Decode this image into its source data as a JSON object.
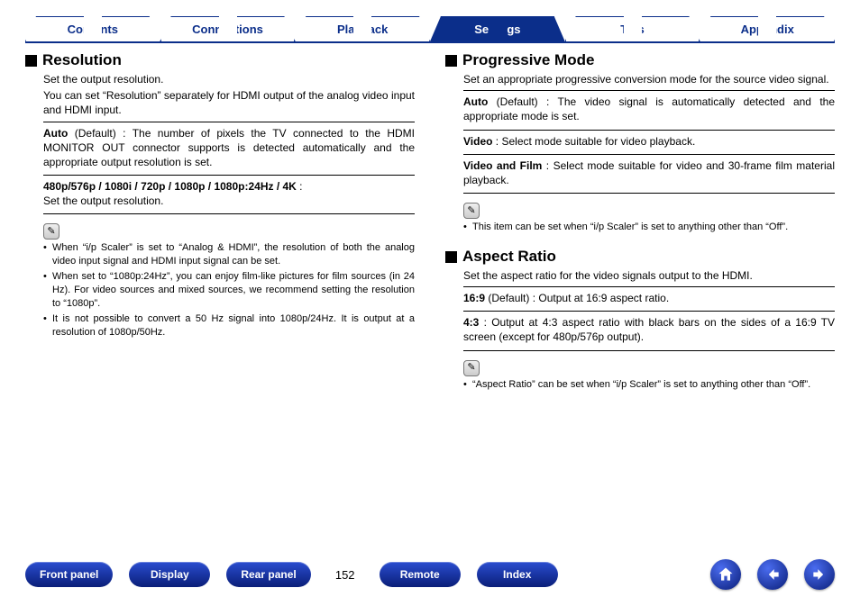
{
  "tabs": [
    {
      "label": "Contents",
      "active": false
    },
    {
      "label": "Connections",
      "active": false
    },
    {
      "label": "Playback",
      "active": false
    },
    {
      "label": "Settings",
      "active": true
    },
    {
      "label": "Tips",
      "active": false
    },
    {
      "label": "Appendix",
      "active": false
    }
  ],
  "left": {
    "resolution": {
      "heading": "Resolution",
      "intro1": "Set the output resolution.",
      "intro2": "You can set “Resolution” separately for HDMI output of the analog video input and HDMI input.",
      "auto_key": "Auto",
      "auto_default": " (Default) : ",
      "auto_desc": "The number of pixels the TV connected to the HDMI MONITOR OUT connector supports is detected automatically and the appropriate output resolution is set.",
      "modes_key": "480p/576p / 1080i / 720p / 1080p / 1080p:24Hz / 4K",
      "modes_sep": " :",
      "modes_desc": "Set the output resolution.",
      "notes": [
        "When “i/p Scaler” is set to “Analog & HDMI”, the resolution of both the analog video input signal and HDMI input signal can be set.",
        "When set to “1080p:24Hz”, you can enjoy film-like pictures for film sources (in 24 Hz). For video sources and mixed sources, we recommend setting the resolution to “1080p”.",
        "It is not possible to convert a 50 Hz signal into 1080p/24Hz. It is output at a resolution of 1080p/50Hz."
      ]
    }
  },
  "right": {
    "progressive": {
      "heading": "Progressive Mode",
      "intro": "Set an appropriate progressive conversion mode for the source video signal.",
      "rows": [
        {
          "key": "Auto",
          "default": " (Default) : ",
          "desc": "The video signal is automatically detected and the appropriate mode is set."
        },
        {
          "key": "Video",
          "default": " : ",
          "desc": "Select mode suitable for video playback."
        },
        {
          "key": "Video and Film",
          "default": " : ",
          "desc": "Select mode suitable for video and 30-frame film material playback."
        }
      ],
      "notes": [
        "This item can be set when “i/p Scaler” is set to anything other than “Off”."
      ]
    },
    "aspect": {
      "heading": "Aspect Ratio",
      "intro": "Set the aspect ratio for the video signals output to the HDMI.",
      "rows": [
        {
          "key": "16:9",
          "default": " (Default) : ",
          "desc": "Output at 16:9 aspect ratio."
        },
        {
          "key": "4:3",
          "default": " : ",
          "desc": "Output at 4:3 aspect ratio with black bars on the sides of a 16:9 TV screen (except for 480p/576p output)."
        }
      ],
      "notes": [
        "“Aspect Ratio” can be set when “i/p Scaler” is set to anything other than “Off”."
      ]
    }
  },
  "footer": {
    "front": "Front panel",
    "display": "Display",
    "rear": "Rear panel",
    "page": "152",
    "remote": "Remote",
    "index": "Index"
  },
  "icons": {
    "pencil": "✎"
  }
}
